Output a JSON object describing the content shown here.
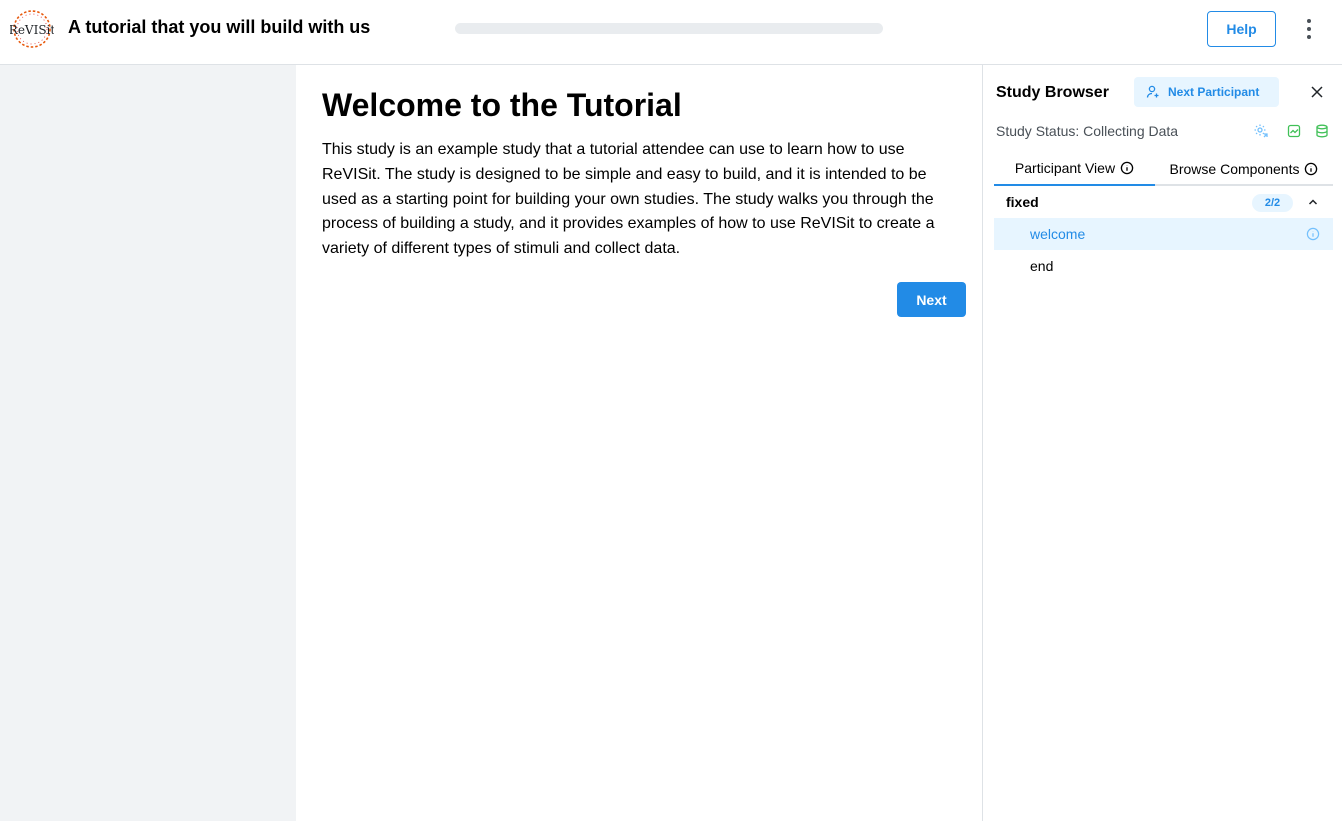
{
  "header": {
    "app_title": "A tutorial that you will build with us",
    "logo_alt": "ReVISit",
    "progress_fraction": 0.0,
    "help_label": "Help",
    "menu_icon": "dots-vertical-icon"
  },
  "main": {
    "title": "Welcome to the Tutorial",
    "body": "This study is an example study that a tutorial attendee can use to learn how to use ReVISit. The study is designed to be simple and easy to build, and it is intended to be used as a starting point for building your own studies. The study walks you through the process of building a study, and it provides examples of how to use ReVISit to create a variety of different types of stimuli and collect data.",
    "next_label": "Next"
  },
  "study_browser": {
    "title": "Study Browser",
    "next_participant_label": "Next Participant",
    "status_text": "Study Status: Collecting Data",
    "tabs": [
      {
        "label": "Participant View",
        "active": true
      },
      {
        "label": "Browse Components",
        "active": false
      }
    ],
    "group": {
      "name": "fixed",
      "count": "2/2"
    },
    "components": [
      {
        "label": "welcome",
        "active": true
      },
      {
        "label": "end",
        "active": false
      }
    ]
  },
  "colors": {
    "accent": "#228be6",
    "accent_light": "#e7f5ff",
    "status_green": "#40c057",
    "panel_grey": "#f1f3f5"
  }
}
